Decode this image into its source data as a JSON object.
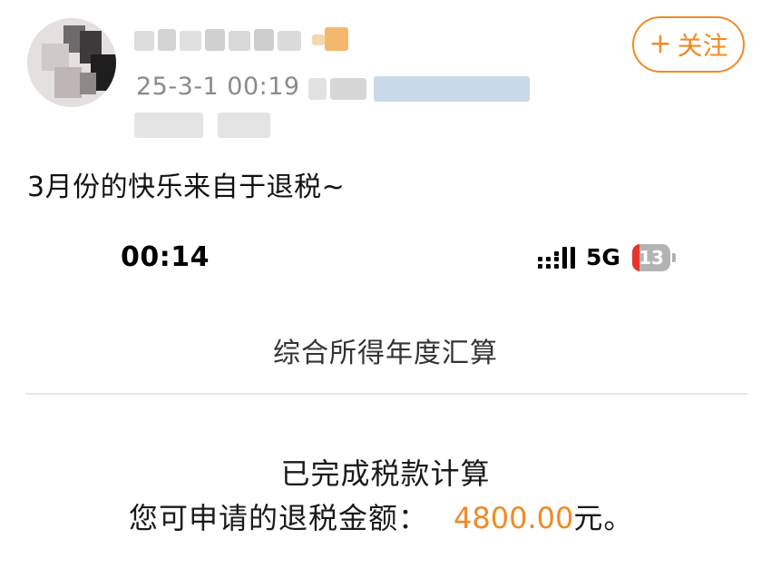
{
  "post": {
    "timestamp": "25-3-1 00:19",
    "follow_label": "关注",
    "follow_plus": "+",
    "text": "3月份的快乐来自于退税~"
  },
  "phone": {
    "time": "00:14",
    "network": "5G",
    "battery": "13",
    "battery_level_percent": 13
  },
  "tax": {
    "title": "综合所得年度汇算",
    "status": "已完成税款计算",
    "refund_label": "您可申请的退税金额：",
    "refund_amount": "4800.00",
    "refund_unit": "元。"
  },
  "colors": {
    "accent": "#f08a24",
    "battery_low": "#e5342c",
    "muted_text": "#8a8a8a"
  }
}
